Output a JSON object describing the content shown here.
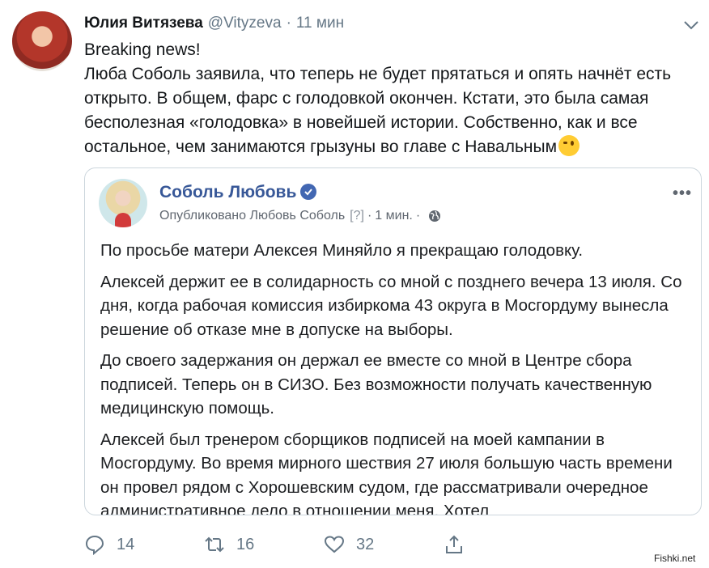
{
  "tweet": {
    "author_name": "Юлия Витязева",
    "handle": "@Vityzeva",
    "separator": "·",
    "time": "11 мин",
    "text": "Breaking news!\nЛюба Соболь заявила, что теперь не будет прятаться и опять начнёт есть открыто. В общем, фарс с голодовкой окончен. Кстати, это была самая бесполезная «голодовка» в новейшей истории. Собственно, как и все остальное, чем занимаются грызуны во главе с Навальным",
    "emoji": "winking-face"
  },
  "embedded_post": {
    "author": "Соболь Любовь",
    "meta_published": "Опубликовано Любовь Соболь",
    "meta_help": "[?]",
    "meta_separator": "·",
    "meta_time": "1 мин.",
    "meta_separator2": "·",
    "more_label": "•••",
    "paragraphs": [
      "По просьбе матери Алексея Миняйло я прекращаю голодовку.",
      "Алексей держит ее в солидарность со мной с позднего вечера 13 июля. Со дня, когда рабочая комиссия избиркома 43 округа в Мосгордуму вынесла решение об отказе мне в допуске на выборы.",
      "До своего задержания он держал ее вместе со мной в Центре сбора подписей. Теперь он в СИЗО. Без возможности получать качественную медицинскую помощь.",
      "Алексей был тренером сборщиков подписей на моей кампании в Мосгордуму. Во время мирного шествия 27 июля большую часть времени он провел рядом с Хорошевским судом, где рассматривали очередное административное дело в отношении меня. Хотел"
    ]
  },
  "actions": {
    "reply_count": "14",
    "retweet_count": "16",
    "like_count": "32"
  },
  "watermark": "Fishki.net",
  "colors": {
    "name_link": "#385898",
    "secondary_text": "#657786",
    "verified": "#4267b2"
  }
}
